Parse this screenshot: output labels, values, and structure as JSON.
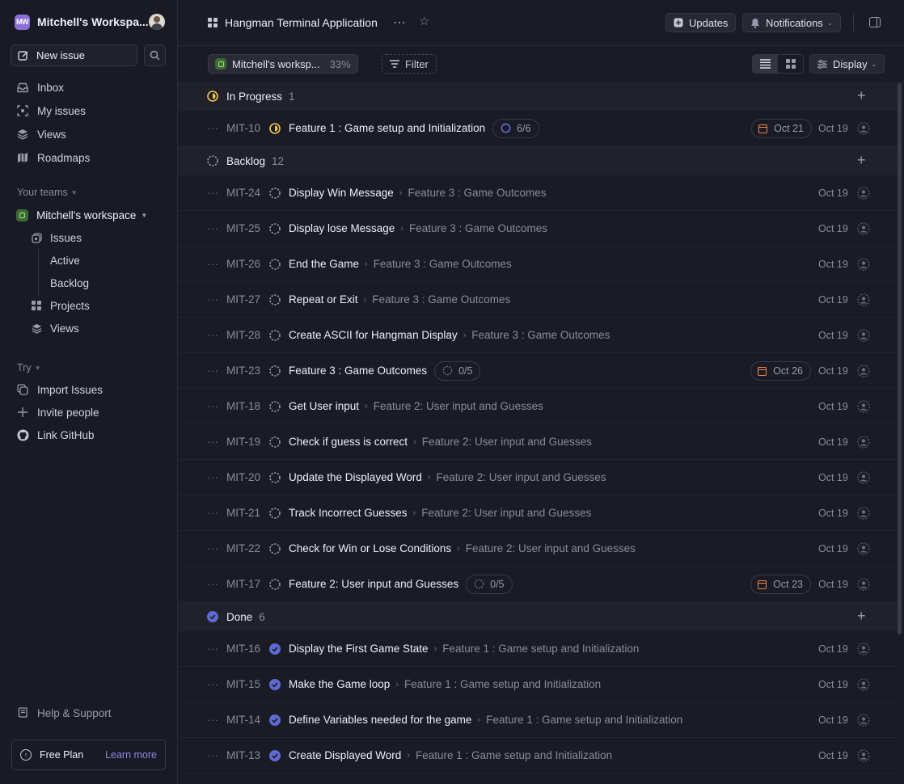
{
  "sidebar": {
    "workspace_badge": "MW",
    "workspace_name": "Mitchell's Workspa...",
    "new_issue": "New issue",
    "nav": [
      {
        "label": "Inbox",
        "icon": "inbox-icon"
      },
      {
        "label": "My issues",
        "icon": "my-issues-icon"
      },
      {
        "label": "Views",
        "icon": "views-icon"
      },
      {
        "label": "Roadmaps",
        "icon": "roadmaps-icon"
      }
    ],
    "teams_label": "Your teams",
    "team_name": "Mitchell's workspace",
    "team_items": [
      {
        "label": "Issues"
      },
      {
        "label": "Active"
      },
      {
        "label": "Backlog"
      },
      {
        "label": "Projects"
      },
      {
        "label": "Views"
      }
    ],
    "try_label": "Try",
    "try_items": [
      {
        "label": "Import Issues"
      },
      {
        "label": "Invite people"
      },
      {
        "label": "Link GitHub"
      }
    ],
    "help": "Help & Support",
    "plan": {
      "label": "Free Plan",
      "link": "Learn more"
    }
  },
  "header": {
    "project_title": "Hangman Terminal Application",
    "updates": "Updates",
    "notifications": "Notifications"
  },
  "filterbar": {
    "workspace_chip": "Mitchell's worksp...",
    "progress": "33%",
    "filter": "Filter",
    "display": "Display"
  },
  "groups": {
    "in_progress": {
      "label": "In Progress",
      "count": "1"
    },
    "backlog": {
      "label": "Backlog",
      "count": "12"
    },
    "done": {
      "label": "Done",
      "count": "6"
    }
  },
  "issues": {
    "r0": {
      "id": "MIT-10",
      "title": "Feature 1 : Game setup and Initialization",
      "sub": "6/6",
      "due": "Oct 21",
      "date": "Oct 19"
    },
    "r1": {
      "id": "MIT-24",
      "title": "Display Win Message",
      "parent": "Feature 3 : Game Outcomes",
      "date": "Oct 19"
    },
    "r2": {
      "id": "MIT-25",
      "title": "Display lose Message",
      "parent": "Feature 3 : Game Outcomes",
      "date": "Oct 19"
    },
    "r3": {
      "id": "MIT-26",
      "title": "End the Game",
      "parent": "Feature 3 : Game Outcomes",
      "date": "Oct 19"
    },
    "r4": {
      "id": "MIT-27",
      "title": "Repeat or Exit",
      "parent": "Feature 3 : Game Outcomes",
      "date": "Oct 19"
    },
    "r5": {
      "id": "MIT-28",
      "title": "Create ASCII for Hangman Display",
      "parent": "Feature 3 : Game Outcomes",
      "date": "Oct 19"
    },
    "r6": {
      "id": "MIT-23",
      "title": "Feature 3 : Game Outcomes",
      "sub": "0/5",
      "due": "Oct 26",
      "date": "Oct 19"
    },
    "r7": {
      "id": "MIT-18",
      "title": "Get User input",
      "parent": "Feature 2: User input and Guesses",
      "date": "Oct 19"
    },
    "r8": {
      "id": "MIT-19",
      "title": "Check if guess is correct",
      "parent": "Feature 2: User input and Guesses",
      "date": "Oct 19"
    },
    "r9": {
      "id": "MIT-20",
      "title": "Update the Displayed Word",
      "parent": "Feature 2: User input and Guesses",
      "date": "Oct 19"
    },
    "r10": {
      "id": "MIT-21",
      "title": "Track Incorrect Guesses",
      "parent": "Feature 2: User input and Guesses",
      "date": "Oct 19"
    },
    "r11": {
      "id": "MIT-22",
      "title": "Check for Win or Lose Conditions",
      "parent": "Feature 2: User input and Guesses",
      "date": "Oct 19"
    },
    "r12": {
      "id": "MIT-17",
      "title": "Feature 2: User input and Guesses",
      "sub": "0/5",
      "due": "Oct 23",
      "date": "Oct 19"
    },
    "r13": {
      "id": "MIT-16",
      "title": "Display the First Game State",
      "parent": "Feature 1 : Game setup and Initialization",
      "date": "Oct 19"
    },
    "r14": {
      "id": "MIT-15",
      "title": "Make the Game loop",
      "parent": "Feature 1 : Game setup and Initialization",
      "date": "Oct 19"
    },
    "r15": {
      "id": "MIT-14",
      "title": "Define Variables needed for the game",
      "parent": "Feature 1 : Game setup and Initialization",
      "date": "Oct 19"
    },
    "r16": {
      "id": "MIT-13",
      "title": "Create Displayed Word",
      "parent": "Feature 1 : Game setup and Initialization",
      "date": "Oct 19"
    }
  },
  "colors": {
    "accent": "#5e6ad2",
    "in_progress": "#f2c94c",
    "due": "#f2884e",
    "team": "#9fe87a"
  }
}
